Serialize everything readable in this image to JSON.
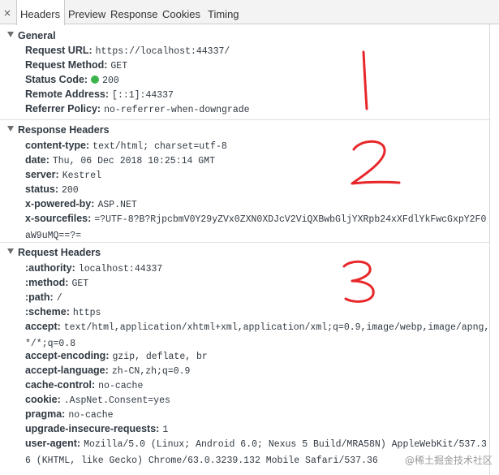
{
  "tabs": {
    "close_glyph": "×",
    "items": [
      {
        "label": "Headers"
      },
      {
        "label": "Preview"
      },
      {
        "label": "Response"
      },
      {
        "label": "Cookies"
      },
      {
        "label": "Timing"
      }
    ],
    "active": "Headers"
  },
  "general": {
    "title": "General",
    "rows": [
      {
        "key": "Request URL:",
        "value": "https://localhost:44337/"
      },
      {
        "key": "Request Method:",
        "value": "GET"
      },
      {
        "key": "Status Code:",
        "value": "200"
      },
      {
        "key": "Remote Address:",
        "value": "[::1]:44337"
      },
      {
        "key": "Referrer Policy:",
        "value": "no-referrer-when-downgrade"
      }
    ]
  },
  "response_headers": {
    "title": "Response Headers",
    "rows": [
      {
        "key": "content-type:",
        "value": "text/html; charset=utf-8"
      },
      {
        "key": "date:",
        "value": "Thu, 06 Dec 2018 10:25:14 GMT"
      },
      {
        "key": "server:",
        "value": "Kestrel"
      },
      {
        "key": "status:",
        "value": "200"
      },
      {
        "key": "x-powered-by:",
        "value": "ASP.NET"
      },
      {
        "key": "x-sourcefiles:",
        "value": "=?UTF-8?B?RjpcbmV0Y29yZVx0ZXN0XDJcV2ViQXBwbGljYXRpb24xXFdlYkFwcGxpY2F0aW9uMQ==?="
      }
    ]
  },
  "request_headers": {
    "title": "Request Headers",
    "rows": [
      {
        "key": ":authority:",
        "value": "localhost:44337"
      },
      {
        "key": ":method:",
        "value": "GET"
      },
      {
        "key": ":path:",
        "value": "/"
      },
      {
        "key": ":scheme:",
        "value": "https"
      },
      {
        "key": "accept:",
        "value": "text/html,application/xhtml+xml,application/xml;q=0.9,image/webp,image/apng,*/*;q=0.8"
      },
      {
        "key": "accept-encoding:",
        "value": "gzip, deflate, br"
      },
      {
        "key": "accept-language:",
        "value": "zh-CN,zh;q=0.9"
      },
      {
        "key": "cache-control:",
        "value": "no-cache"
      },
      {
        "key": "cookie:",
        "value": ".AspNet.Consent=yes"
      },
      {
        "key": "pragma:",
        "value": "no-cache"
      },
      {
        "key": "upgrade-insecure-requests:",
        "value": "1"
      },
      {
        "key": "user-agent:",
        "value": "Mozilla/5.0 (Linux; Android 6.0; Nexus 5 Build/MRA58N) AppleWebKit/537.36 (KHTML, like Gecko) Chrome/63.0.3239.132 Mobile Safari/537.36"
      }
    ]
  },
  "annotations": [
    "1",
    "2",
    "3"
  ],
  "watermark": "@稀土掘金技术社区",
  "colors": {
    "status_ok": "#3cb44b",
    "annotation": "#e8272a",
    "tab_bar": "#f3f3f3"
  }
}
